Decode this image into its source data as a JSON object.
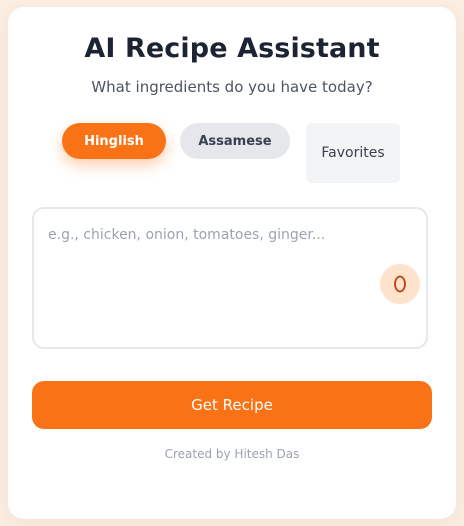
{
  "header": {
    "title": "AI Recipe Assistant",
    "subtitle": "What ingredients do you have today?"
  },
  "language_buttons": {
    "hinglish": "Hinglish",
    "assamese": "Assamese",
    "favorites": "Favorites",
    "selected": "Hinglish"
  },
  "ingredients": {
    "value": "",
    "placeholder": "e.g., chicken, onion, tomatoes, ginger...",
    "mic_icon": "microphone-icon"
  },
  "actions": {
    "get_recipe": "Get Recipe"
  },
  "footer": {
    "credit": "Created by Hitesh Das"
  },
  "colors": {
    "accent": "#f97316",
    "background": "#fbefe3",
    "card": "#ffffff",
    "title": "#1c2433",
    "mic_bg": "#fde3cc"
  }
}
